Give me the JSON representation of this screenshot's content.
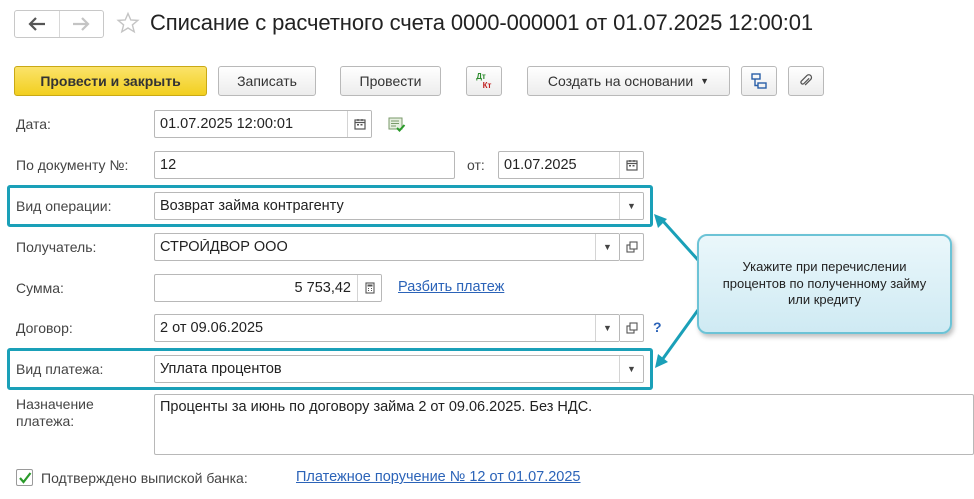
{
  "header": {
    "title": "Списание с расчетного счета 0000-000001 от 01.07.2025 12:00:01"
  },
  "toolbar": {
    "post_close": "Провести и закрыть",
    "save": "Записать",
    "post": "Провести",
    "dt_kt_top": "Дт",
    "dt_kt_bottom": "Кт",
    "create_based": "Создать на основании"
  },
  "form": {
    "date": {
      "label": "Дата:",
      "value": "01.07.2025 12:00:01"
    },
    "doc_number": {
      "label": "По документу №:",
      "value": "12",
      "from_label": "от:",
      "from_value": "01.07.2025"
    },
    "operation_type": {
      "label": "Вид операции:",
      "value": "Возврат займа контрагенту"
    },
    "recipient": {
      "label": "Получатель:",
      "value": "СТРОЙДВОР ООО"
    },
    "amount": {
      "label": "Сумма:",
      "value": "5 753,42",
      "split_link": "Разбить платеж"
    },
    "contract": {
      "label": "Договор:",
      "value": "2 от 09.06.2025",
      "help": "?"
    },
    "payment_type": {
      "label": "Вид платежа:",
      "value": "Уплата процентов"
    },
    "purpose": {
      "label_line1": "Назначение",
      "label_line2": "платежа:",
      "value": "Проценты за июнь по договору займа 2 от 09.06.2025. Без НДС."
    },
    "confirmed": {
      "label": "Подтверждено выпиской банка:",
      "checked": true,
      "link": "Платежное поручение № 12 от 01.07.2025"
    }
  },
  "callout": {
    "text": "Укажите при перечислении процентов по полученному займу или кредиту"
  },
  "colors": {
    "accent_highlight": "#1aa0b8",
    "primary_button": "#f2cf1f",
    "link": "#2b63b8"
  }
}
